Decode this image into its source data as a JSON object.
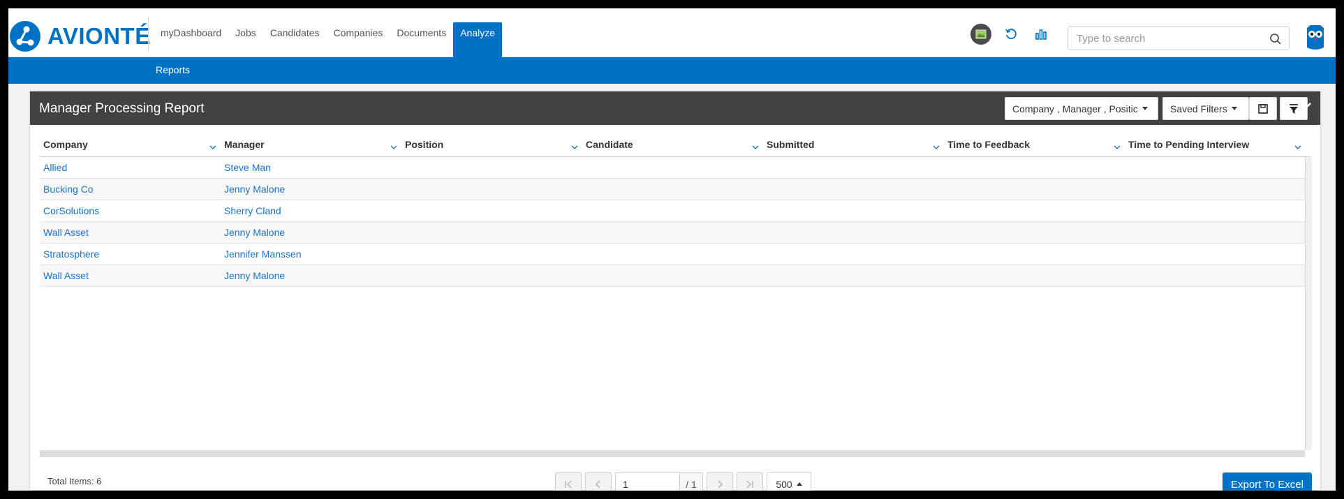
{
  "brand": {
    "name": "AVIONTÉ",
    "color": "#0072c6"
  },
  "nav": {
    "items": [
      {
        "label": "myDashboard"
      },
      {
        "label": "Jobs"
      },
      {
        "label": "Candidates"
      },
      {
        "label": "Companies"
      },
      {
        "label": "Documents"
      },
      {
        "label": "Analyze",
        "active": true
      }
    ]
  },
  "subnav": {
    "items": [
      {
        "label": "Reports"
      }
    ]
  },
  "search": {
    "placeholder": "Type to search"
  },
  "report": {
    "title": "Manager Processing Report",
    "columns_filter_label": "Company , Manager , Positic",
    "saved_filters_label": "Saved Filters"
  },
  "table": {
    "headers": [
      "Company",
      "Manager",
      "Position",
      "Candidate",
      "Submitted",
      "Time to Feedback",
      "Time to Pending Interview"
    ],
    "rows": [
      {
        "company": "Allied",
        "manager": "Steve Man"
      },
      {
        "company": "Bucking Co",
        "manager": "Jenny Malone"
      },
      {
        "company": "CorSolutions",
        "manager": "Sherry Cland"
      },
      {
        "company": "Wall Asset",
        "manager": "Jenny Malone"
      },
      {
        "company": "Stratosphere",
        "manager": "Jennifer Manssen"
      },
      {
        "company": "Wall Asset",
        "manager": "Jenny Malone"
      }
    ]
  },
  "footer": {
    "total_items": "Total Items: 6",
    "page_value": "1",
    "page_of": "/ 1",
    "page_size": "500",
    "export_label": "Export To Excel"
  }
}
